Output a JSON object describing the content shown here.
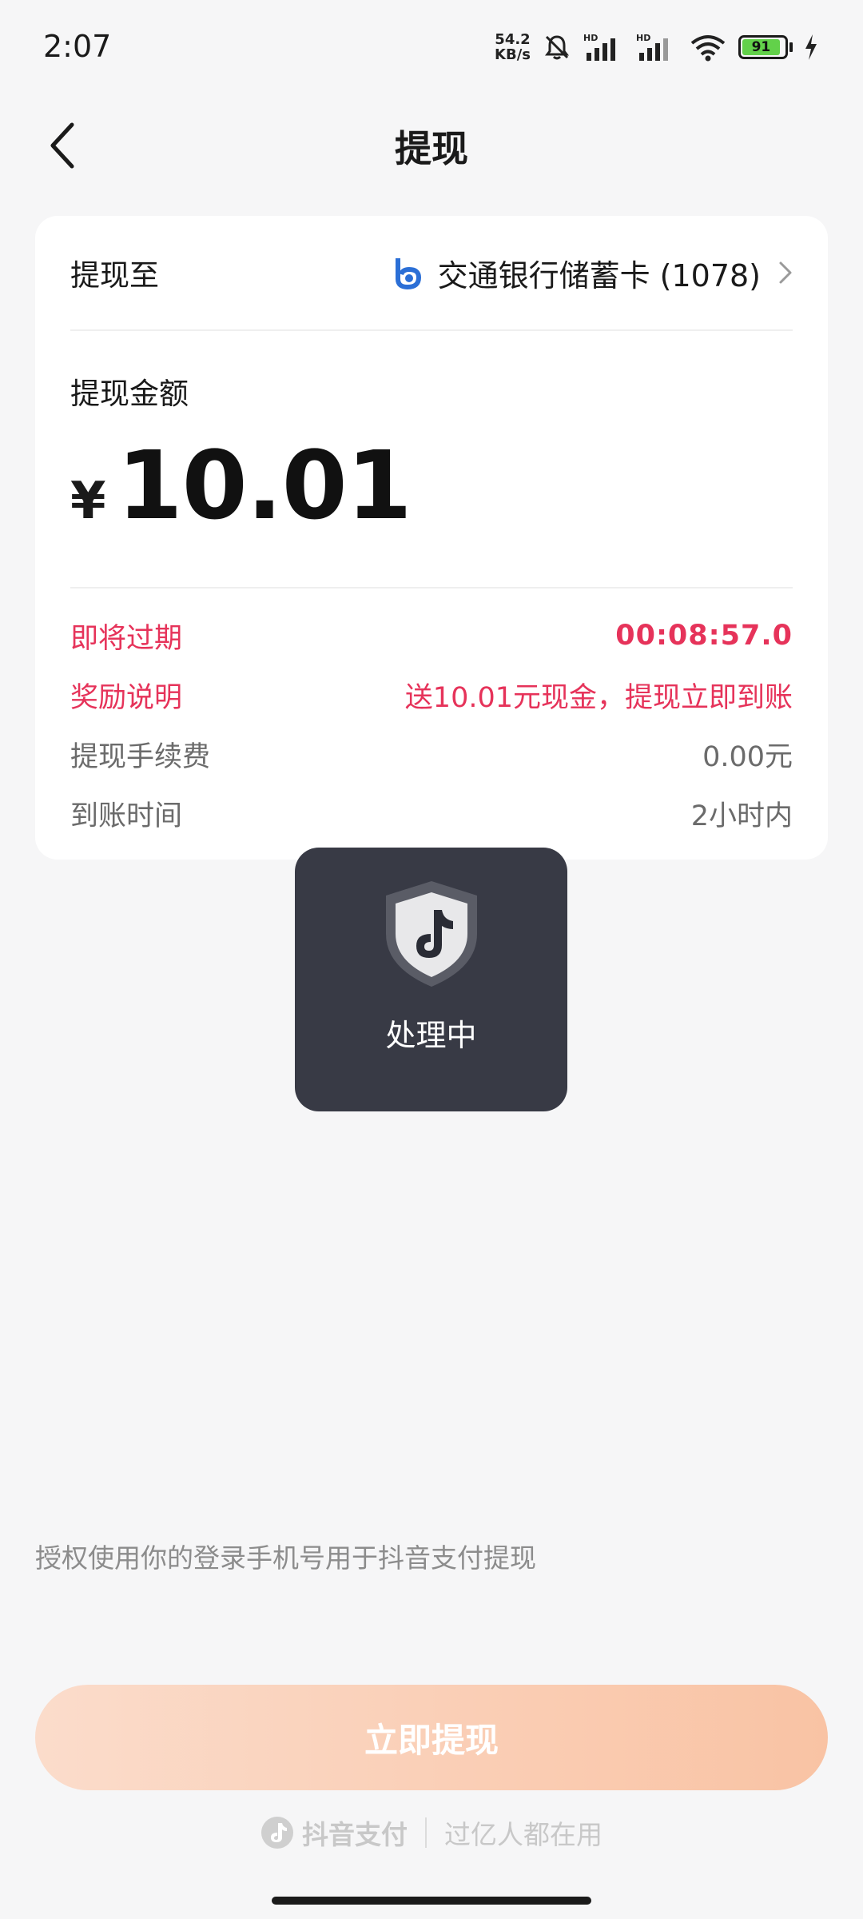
{
  "status_bar": {
    "time": "2:07",
    "net_speed_value": "54.2",
    "net_speed_unit": "KB/s",
    "battery_level": "91",
    "icons": [
      "mute-bell-icon",
      "hd-signal-icon",
      "hd-signal-icon",
      "wifi-icon",
      "battery-icon",
      "charging-icon"
    ]
  },
  "header": {
    "title": "提现",
    "back_icon": "chevron-left-icon"
  },
  "card": {
    "destination_label": "提现至",
    "bank_name": "交通银行储蓄卡 (1078)",
    "bank_icon": "bocom-logo-icon",
    "amount_label": "提现金额",
    "currency_symbol": "¥",
    "amount": "10.01",
    "rows": [
      {
        "label": "即将过期",
        "value": "00:08:57.0"
      },
      {
        "label": "奖励说明",
        "value": "送10.01元现金，提现立即到账"
      },
      {
        "label": "提现手续费",
        "value": "0.00元"
      },
      {
        "label": "到账时间",
        "value": "2小时内"
      }
    ]
  },
  "toast": {
    "text": "处理中",
    "icon": "douyin-shield-icon"
  },
  "footer": {
    "auth_text": "授权使用你的登录手机号用于抖音支付提现",
    "submit_label": "立即提现",
    "brand_name": "抖音支付",
    "brand_slogan": "过亿人都在用"
  },
  "colors": {
    "accent_red": "#e6335a",
    "button_gradient_start": "#fbdccb",
    "button_gradient_end": "#f9c3a4",
    "toast_bg": "#383a45"
  }
}
